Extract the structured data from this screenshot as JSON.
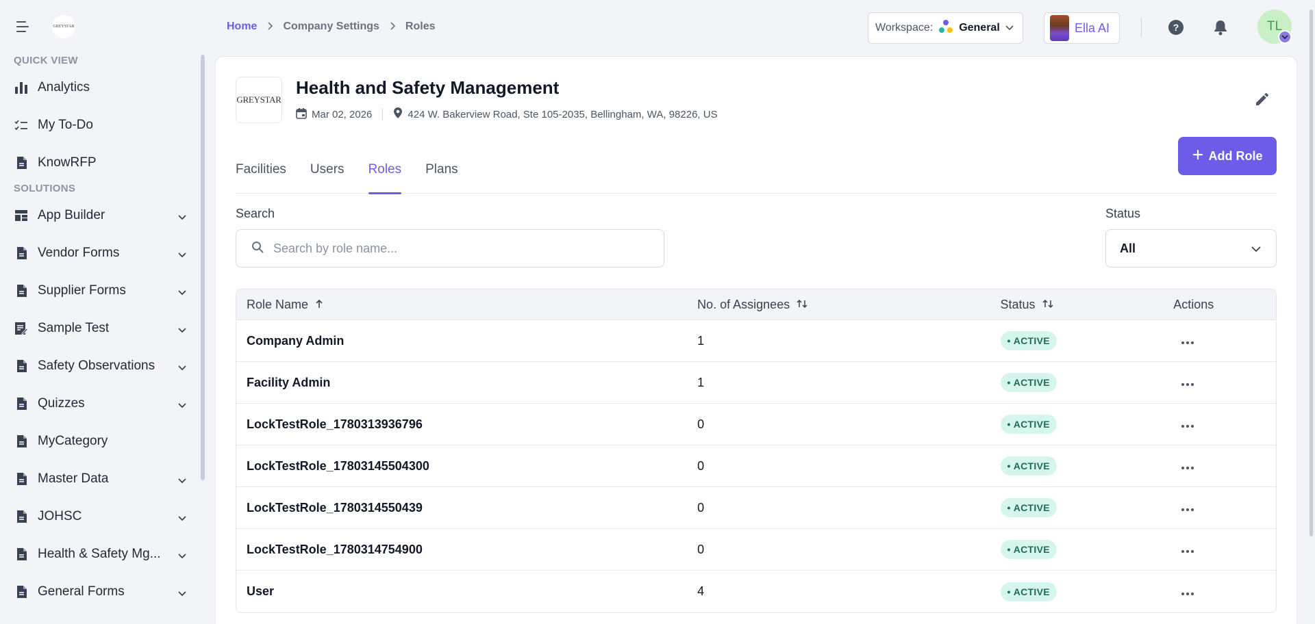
{
  "sidebar": {
    "sections": [
      {
        "title": "QUICK VIEW",
        "items": [
          {
            "label": "Analytics",
            "icon": "bar-chart-icon",
            "expandable": false
          },
          {
            "label": "My To-Do",
            "icon": "checklist-icon",
            "expandable": false
          },
          {
            "label": "KnowRFP",
            "icon": "document-icon",
            "expandable": false
          }
        ]
      },
      {
        "title": "SOLUTIONS",
        "items": [
          {
            "label": "App Builder",
            "icon": "dashboard-icon",
            "expandable": true
          },
          {
            "label": "Vendor Forms",
            "icon": "document-icon",
            "expandable": true
          },
          {
            "label": "Supplier Forms",
            "icon": "document-icon",
            "expandable": true
          },
          {
            "label": "Sample Test",
            "icon": "edit-document-icon",
            "expandable": true
          },
          {
            "label": "Safety Observations",
            "icon": "document-icon",
            "expandable": true
          },
          {
            "label": "Quizzes",
            "icon": "document-icon",
            "expandable": true
          },
          {
            "label": "MyCategory",
            "icon": "document-icon",
            "expandable": false
          },
          {
            "label": "Master Data",
            "icon": "document-icon",
            "expandable": true
          },
          {
            "label": "JOHSC",
            "icon": "document-icon",
            "expandable": true
          },
          {
            "label": "Health & Safety Mg...",
            "icon": "document-icon",
            "expandable": true
          },
          {
            "label": "General Forms",
            "icon": "document-icon",
            "expandable": true
          }
        ]
      }
    ]
  },
  "header": {
    "breadcrumb": [
      "Home",
      "Company Settings",
      "Roles"
    ],
    "workspace_label": "Workspace:",
    "workspace_value": "General",
    "ella_label": "Ella AI",
    "avatar_initials": "TL"
  },
  "company": {
    "logo_text": "GREYSTAR",
    "name": "Health and Safety Management",
    "date": "Mar 02, 2026",
    "address": "424 W. Bakerview Road, Ste 105-2035, Bellingham, WA, 98226, US"
  },
  "tabs": [
    "Facilities",
    "Users",
    "Roles",
    "Plans"
  ],
  "active_tab": "Roles",
  "add_role_label": "Add Role",
  "filters": {
    "search_label": "Search",
    "search_placeholder": "Search by role name...",
    "status_label": "Status",
    "status_value": "All"
  },
  "table": {
    "columns": [
      "Role Name",
      "No. of Assignees",
      "Status",
      "Actions"
    ],
    "rows": [
      {
        "name": "Company Admin",
        "assignees": "1",
        "status": "ACTIVE"
      },
      {
        "name": "Facility Admin",
        "assignees": "1",
        "status": "ACTIVE"
      },
      {
        "name": "LockTestRole_1780313936796",
        "assignees": "0",
        "status": "ACTIVE"
      },
      {
        "name": "LockTestRole_17803145504300",
        "assignees": "0",
        "status": "ACTIVE"
      },
      {
        "name": "LockTestRole_1780314550439",
        "assignees": "0",
        "status": "ACTIVE"
      },
      {
        "name": "LockTestRole_1780314754900",
        "assignees": "0",
        "status": "ACTIVE"
      },
      {
        "name": "User",
        "assignees": "4",
        "status": "ACTIVE"
      }
    ]
  },
  "colors": {
    "accent": "#6c5ce7",
    "badge_bg": "#d6f5ec",
    "badge_text": "#1f6b53"
  }
}
